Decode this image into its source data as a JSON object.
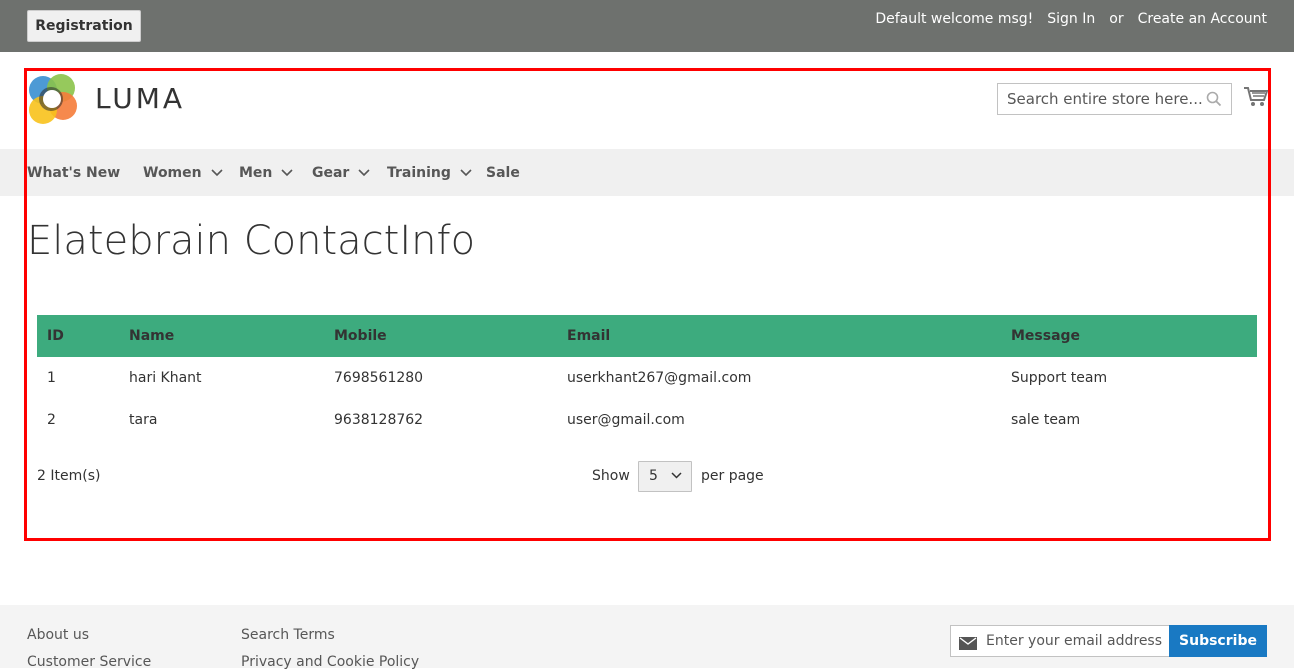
{
  "header": {
    "registration_button": "Registration",
    "welcome": "Default welcome msg!",
    "sign_in": "Sign In",
    "or": "or",
    "create_account": "Create an Account"
  },
  "logo": {
    "text": "LUMA"
  },
  "search": {
    "placeholder": "Search entire store here..."
  },
  "nav": {
    "items": [
      {
        "label": "What's New",
        "has_dropdown": false
      },
      {
        "label": "Women",
        "has_dropdown": true
      },
      {
        "label": "Men",
        "has_dropdown": true
      },
      {
        "label": "Gear",
        "has_dropdown": true
      },
      {
        "label": "Training",
        "has_dropdown": true
      },
      {
        "label": "Sale",
        "has_dropdown": false
      }
    ]
  },
  "page": {
    "title": "Elatebrain ContactInfo"
  },
  "table": {
    "columns": [
      "ID",
      "Name",
      "Mobile",
      "Email",
      "Message"
    ],
    "rows": [
      [
        "1",
        "hari Khant",
        "7698561280",
        "userkhant267@gmail.com",
        "Support team"
      ],
      [
        "2",
        "tara",
        "9638128762",
        "user@gmail.com",
        "sale team"
      ]
    ],
    "header_color": "#3dab7e"
  },
  "pager": {
    "items_count": "2 Item(s)",
    "show_label": "Show",
    "limit_value": "5",
    "per_page_label": "per page"
  },
  "footer": {
    "col1": [
      "About us",
      "Customer Service"
    ],
    "col2": [
      "Search Terms",
      "Privacy and Cookie Policy"
    ],
    "newsletter_placeholder": "Enter your email address",
    "subscribe_label": "Subscribe"
  },
  "colors": {
    "topbar": "#6e716e",
    "highlight_border": "#ff0000",
    "subscribe_button": "#1979c3"
  }
}
